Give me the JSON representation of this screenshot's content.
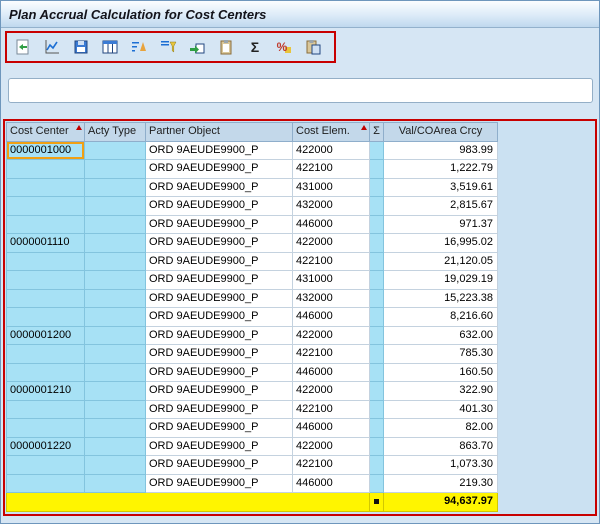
{
  "title": "Plan Accrual Calculation for Cost Centers",
  "colors": {
    "annotation": "#C80000",
    "total_row": "#FFF500",
    "key_column": "#A7E1F5"
  },
  "toolbar": {
    "icons": [
      {
        "name": "refresh-icon"
      },
      {
        "name": "graphic-icon"
      },
      {
        "name": "save-icon"
      },
      {
        "name": "choose-layout-icon"
      },
      {
        "name": "sort-ascending-icon"
      },
      {
        "name": "filter-icon"
      },
      {
        "name": "export-icon"
      },
      {
        "name": "copy-icon"
      },
      {
        "name": "total-icon"
      },
      {
        "name": "percentage-icon"
      },
      {
        "name": "paste-icon"
      }
    ]
  },
  "input_area": {
    "value": ""
  },
  "table": {
    "headers": [
      {
        "key": "cost-center",
        "label": "Cost Center",
        "sorted": true,
        "align": "left"
      },
      {
        "key": "acty-type",
        "label": "Acty Type",
        "sorted": false,
        "align": "left"
      },
      {
        "key": "partner-object",
        "label": "Partner Object",
        "sorted": false,
        "align": "left"
      },
      {
        "key": "cost-elem",
        "label": "Cost Elem.",
        "sorted": true,
        "align": "left"
      },
      {
        "key": "sum",
        "label": "Σ",
        "sorted": false,
        "align": "center"
      },
      {
        "key": "value",
        "label": "Val/COArea Crcy",
        "sorted": false,
        "align": "center"
      }
    ],
    "rows": [
      {
        "cost_center": "0000001000",
        "acty_type": "",
        "partner_object": "ORD 9AEUDE9900_P",
        "cost_elem": "422000",
        "value": "983.99",
        "selected": true
      },
      {
        "cost_center": "",
        "acty_type": "",
        "partner_object": "ORD 9AEUDE9900_P",
        "cost_elem": "422100",
        "value": "1,222.79",
        "selected": false
      },
      {
        "cost_center": "",
        "acty_type": "",
        "partner_object": "ORD 9AEUDE9900_P",
        "cost_elem": "431000",
        "value": "3,519.61",
        "selected": false
      },
      {
        "cost_center": "",
        "acty_type": "",
        "partner_object": "ORD 9AEUDE9900_P",
        "cost_elem": "432000",
        "value": "2,815.67",
        "selected": false
      },
      {
        "cost_center": "",
        "acty_type": "",
        "partner_object": "ORD 9AEUDE9900_P",
        "cost_elem": "446000",
        "value": "971.37",
        "selected": false
      },
      {
        "cost_center": "0000001110",
        "acty_type": "",
        "partner_object": "ORD 9AEUDE9900_P",
        "cost_elem": "422000",
        "value": "16,995.02",
        "selected": false
      },
      {
        "cost_center": "",
        "acty_type": "",
        "partner_object": "ORD 9AEUDE9900_P",
        "cost_elem": "422100",
        "value": "21,120.05",
        "selected": false
      },
      {
        "cost_center": "",
        "acty_type": "",
        "partner_object": "ORD 9AEUDE9900_P",
        "cost_elem": "431000",
        "value": "19,029.19",
        "selected": false
      },
      {
        "cost_center": "",
        "acty_type": "",
        "partner_object": "ORD 9AEUDE9900_P",
        "cost_elem": "432000",
        "value": "15,223.38",
        "selected": false
      },
      {
        "cost_center": "",
        "acty_type": "",
        "partner_object": "ORD 9AEUDE9900_P",
        "cost_elem": "446000",
        "value": "8,216.60",
        "selected": false
      },
      {
        "cost_center": "0000001200",
        "acty_type": "",
        "partner_object": "ORD 9AEUDE9900_P",
        "cost_elem": "422000",
        "value": "632.00",
        "selected": false
      },
      {
        "cost_center": "",
        "acty_type": "",
        "partner_object": "ORD 9AEUDE9900_P",
        "cost_elem": "422100",
        "value": "785.30",
        "selected": false
      },
      {
        "cost_center": "",
        "acty_type": "",
        "partner_object": "ORD 9AEUDE9900_P",
        "cost_elem": "446000",
        "value": "160.50",
        "selected": false
      },
      {
        "cost_center": "0000001210",
        "acty_type": "",
        "partner_object": "ORD 9AEUDE9900_P",
        "cost_elem": "422000",
        "value": "322.90",
        "selected": false
      },
      {
        "cost_center": "",
        "acty_type": "",
        "partner_object": "ORD 9AEUDE9900_P",
        "cost_elem": "422100",
        "value": "401.30",
        "selected": false
      },
      {
        "cost_center": "",
        "acty_type": "",
        "partner_object": "ORD 9AEUDE9900_P",
        "cost_elem": "446000",
        "value": "82.00",
        "selected": false
      },
      {
        "cost_center": "0000001220",
        "acty_type": "",
        "partner_object": "ORD 9AEUDE9900_P",
        "cost_elem": "422000",
        "value": "863.70",
        "selected": false
      },
      {
        "cost_center": "",
        "acty_type": "",
        "partner_object": "ORD 9AEUDE9900_P",
        "cost_elem": "422100",
        "value": "1,073.30",
        "selected": false
      },
      {
        "cost_center": "",
        "acty_type": "",
        "partner_object": "ORD 9AEUDE9900_P",
        "cost_elem": "446000",
        "value": "219.30",
        "selected": false
      }
    ],
    "total": {
      "value": "94,637.97"
    }
  }
}
